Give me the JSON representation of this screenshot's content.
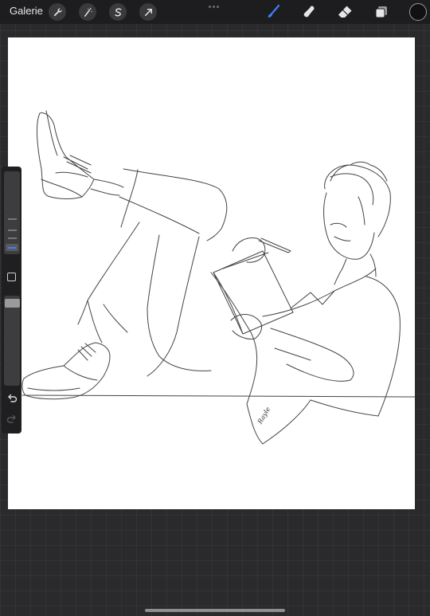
{
  "topbar": {
    "gallery_label": "Galerie",
    "left_tools": [
      "wrench-icon",
      "magic-wand-icon",
      "selection-icon",
      "transform-arrow-icon"
    ],
    "right_tools": [
      "brush-icon",
      "smudge-icon",
      "eraser-icon",
      "layers-icon"
    ],
    "active_tool": "brush-icon",
    "active_color": "#111111",
    "accent_color": "#3b82f6"
  },
  "canvas": {
    "signature": "Rayle"
  },
  "sidebar": {
    "controls": [
      "brush-size-slider",
      "modify-button",
      "opacity-slider",
      "undo-icon",
      "redo-icon"
    ]
  }
}
